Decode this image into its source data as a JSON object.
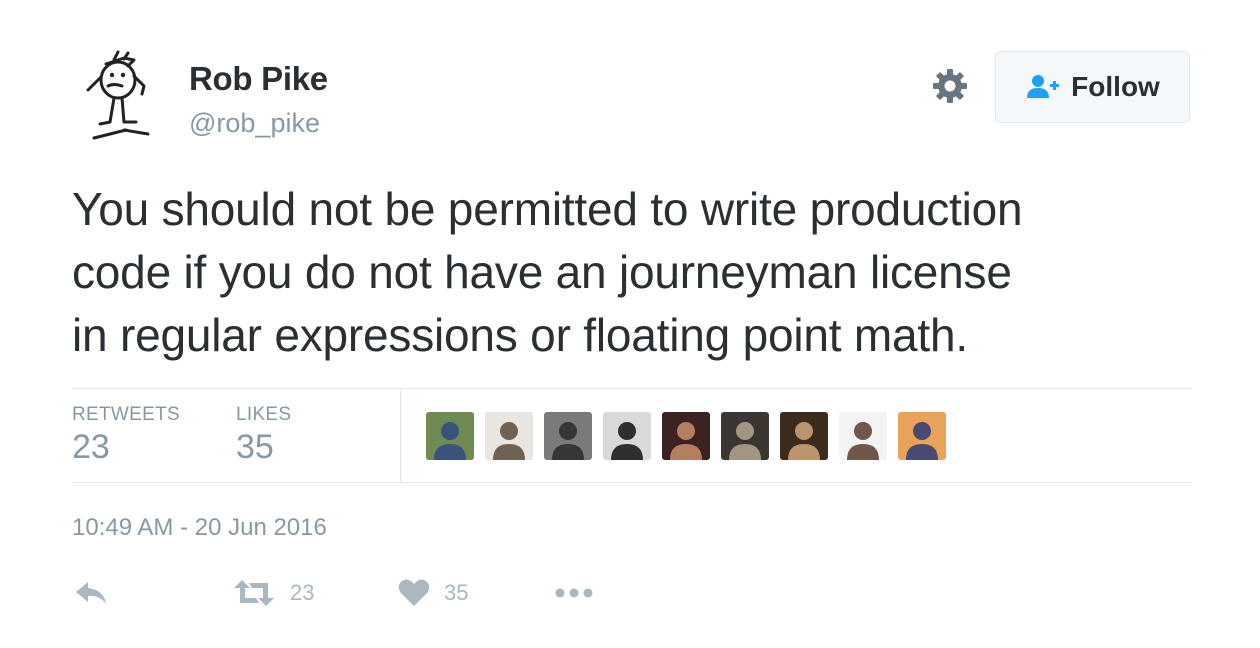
{
  "user": {
    "name": "Rob Pike",
    "handle": "@rob_pike"
  },
  "header": {
    "follow_label": "Follow",
    "gear_icon": "gear-icon",
    "follow_icon": "add-user-icon"
  },
  "tweet": {
    "text_lines": [
      "You should not be permitted to write production",
      "code if you do not have an journeyman license",
      "in regular expressions or floating point math."
    ],
    "timestamp": "10:49 AM - 20 Jun 2016"
  },
  "stats": {
    "retweets_label": "RETWEETS",
    "retweets_value": "23",
    "likes_label": "LIKES",
    "likes_value": "35"
  },
  "likers": [
    {
      "icon": "liker-avatar-1",
      "bg": "#6f8a52",
      "fg": "#2f4a86"
    },
    {
      "icon": "liker-avatar-2",
      "bg": "#e9e6e2",
      "fg": "#5a4a3a"
    },
    {
      "icon": "liker-avatar-3",
      "bg": "#7a7a7a",
      "fg": "#2a2a2a"
    },
    {
      "icon": "liker-avatar-4",
      "bg": "#d9d9d9",
      "fg": "#111111"
    },
    {
      "icon": "liker-avatar-5",
      "bg": "#3a2320",
      "fg": "#c98f6a"
    },
    {
      "icon": "liker-avatar-6",
      "bg": "#3b3631",
      "fg": "#b5a790"
    },
    {
      "icon": "liker-avatar-7",
      "bg": "#3a2b1c",
      "fg": "#d2a77b"
    },
    {
      "icon": "liker-avatar-8",
      "bg": "#f4f4f4",
      "fg": "#5a3a2a"
    },
    {
      "icon": "liker-avatar-9",
      "bg": "#e8a25a",
      "fg": "#2c3b78"
    }
  ],
  "actions": {
    "reply_icon": "reply-icon",
    "retweet_icon": "retweet-icon",
    "retweet_count": "23",
    "like_icon": "heart-icon",
    "like_count": "35",
    "more_icon": "more-icon"
  },
  "colors": {
    "text": "#292f33",
    "muted": "#8899a6",
    "action": "#aab8c2",
    "accent": "#1da1f2",
    "border": "#e1e8ed"
  }
}
